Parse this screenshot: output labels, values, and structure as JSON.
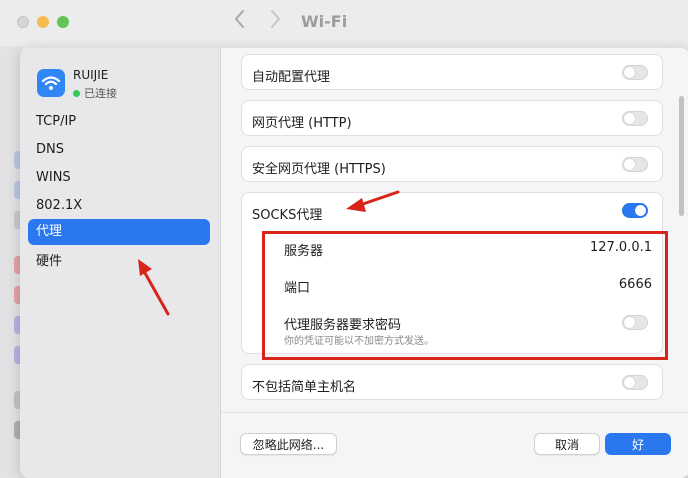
{
  "background_window": {
    "title": "Wi-Fi",
    "back_arrow": "chevron-left",
    "forward_arrow": "chevron-right"
  },
  "network": {
    "name": "RUIJIE",
    "status": "已连接",
    "icon": "wifi-icon",
    "status_color": "#35c759"
  },
  "sidebar": {
    "items": [
      {
        "label": "TCP/IP"
      },
      {
        "label": "DNS"
      },
      {
        "label": "WINS"
      },
      {
        "label": "802.1X"
      },
      {
        "label": "代理"
      },
      {
        "label": "硬件"
      }
    ],
    "active_index": 4
  },
  "proxies": {
    "auto_config": {
      "label": "自动配置代理",
      "enabled": false
    },
    "http": {
      "label": "网页代理 (HTTP)",
      "enabled": false
    },
    "https": {
      "label": "安全网页代理 (HTTPS)",
      "enabled": false
    },
    "socks": {
      "label": "SOCKS代理",
      "enabled": true,
      "server_label": "服务器",
      "server_value": "127.0.0.1",
      "port_label": "端口",
      "port_value": "6666",
      "auth_label": "代理服务器要求密码",
      "auth_desc": "你的凭证可能以不加密方式发送。",
      "auth_enabled": false
    },
    "exclude_simple": {
      "label": "不包括简单主机名",
      "enabled": false
    }
  },
  "footer": {
    "ignore_button": "忽略此网络...",
    "cancel_button": "取消",
    "ok_button": "好"
  },
  "colors": {
    "accent": "#2a77f0",
    "annotation_red": "#d8251c"
  }
}
